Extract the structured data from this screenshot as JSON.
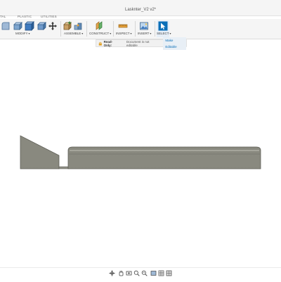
{
  "window": {
    "title": "Lasknter_V2 v2*"
  },
  "tabs": [
    {
      "label": "TAL"
    },
    {
      "label": "PLASTIC"
    },
    {
      "label": "UTILITIES"
    }
  ],
  "toolbar": {
    "groups": [
      {
        "label": "MODIFY",
        "icons": [
          "fillet-icon",
          "press-pull-icon",
          "shell-icon",
          "move-icon"
        ]
      },
      {
        "label": "ASSEMBLE",
        "icons": [
          "new-component-icon",
          "joint-icon"
        ]
      },
      {
        "label": "CONSTRUCT",
        "icons": [
          "offset-plane-icon"
        ]
      },
      {
        "label": "INSPECT",
        "icons": [
          "measure-icon"
        ]
      },
      {
        "label": "INSERT",
        "icons": [
          "insert-image-icon"
        ]
      },
      {
        "label": "SELECT",
        "icons": [
          "select-arrow-icon"
        ]
      }
    ],
    "accent_color": "#0b6fb8"
  },
  "banner": {
    "status": "Read-Only:",
    "message": "Document is not editable",
    "action": "Make Editable"
  },
  "navigation_bar": {
    "icons": [
      "orbit-icon",
      "pan-icon",
      "look-at-icon",
      "zoom-icon",
      "fit-icon",
      "display-settings-icon",
      "grid-icon",
      "viewports-icon"
    ]
  }
}
